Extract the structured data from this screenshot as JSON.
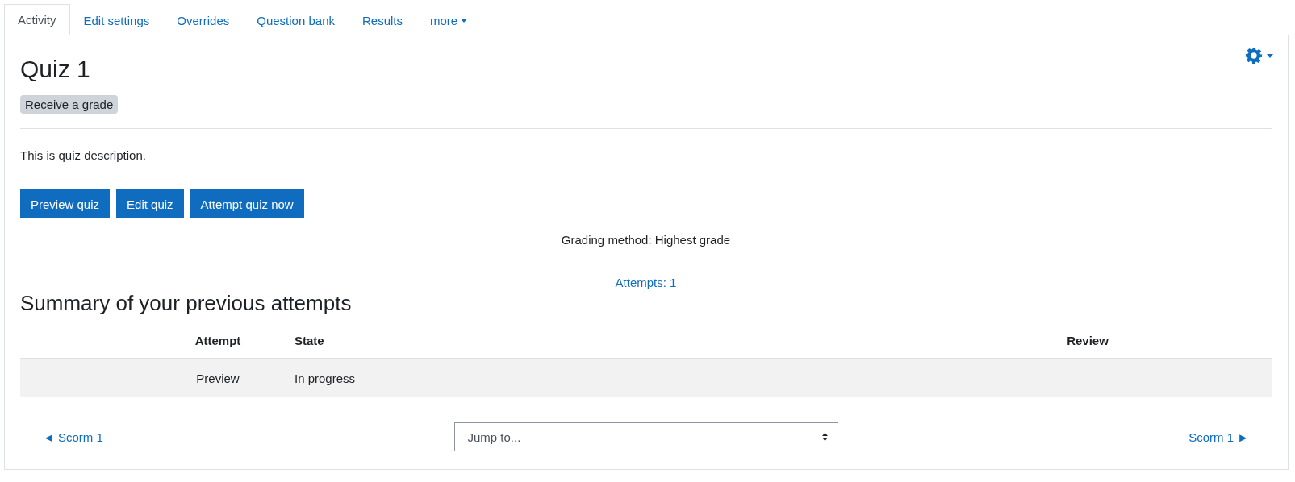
{
  "tabs": [
    {
      "label": "Activity",
      "selected": true,
      "kind": "tab"
    },
    {
      "label": "Edit settings",
      "selected": false,
      "kind": "tab"
    },
    {
      "label": "Overrides",
      "selected": false,
      "kind": "tab"
    },
    {
      "label": "Question bank",
      "selected": false,
      "kind": "tab"
    },
    {
      "label": "Results",
      "selected": false,
      "kind": "tab"
    },
    {
      "label": "more",
      "selected": false,
      "kind": "dropdown"
    }
  ],
  "title": "Quiz 1",
  "badge": "Receive a grade",
  "description": "This is quiz description.",
  "buttons": [
    "Preview quiz",
    "Edit quiz",
    "Attempt quiz now"
  ],
  "grading_method": "Grading method: Highest grade",
  "attempts_link": "Attempts: 1",
  "summary_heading": "Summary of your previous attempts",
  "table": {
    "columns": [
      "Attempt",
      "State",
      "Review"
    ],
    "rows": [
      {
        "cells": [
          "Preview",
          "In progress",
          ""
        ]
      }
    ]
  },
  "footer": {
    "prev_link": "◄ Scorm 1",
    "jump": "Jump to...",
    "next_link": "Scorm 1 ►"
  }
}
